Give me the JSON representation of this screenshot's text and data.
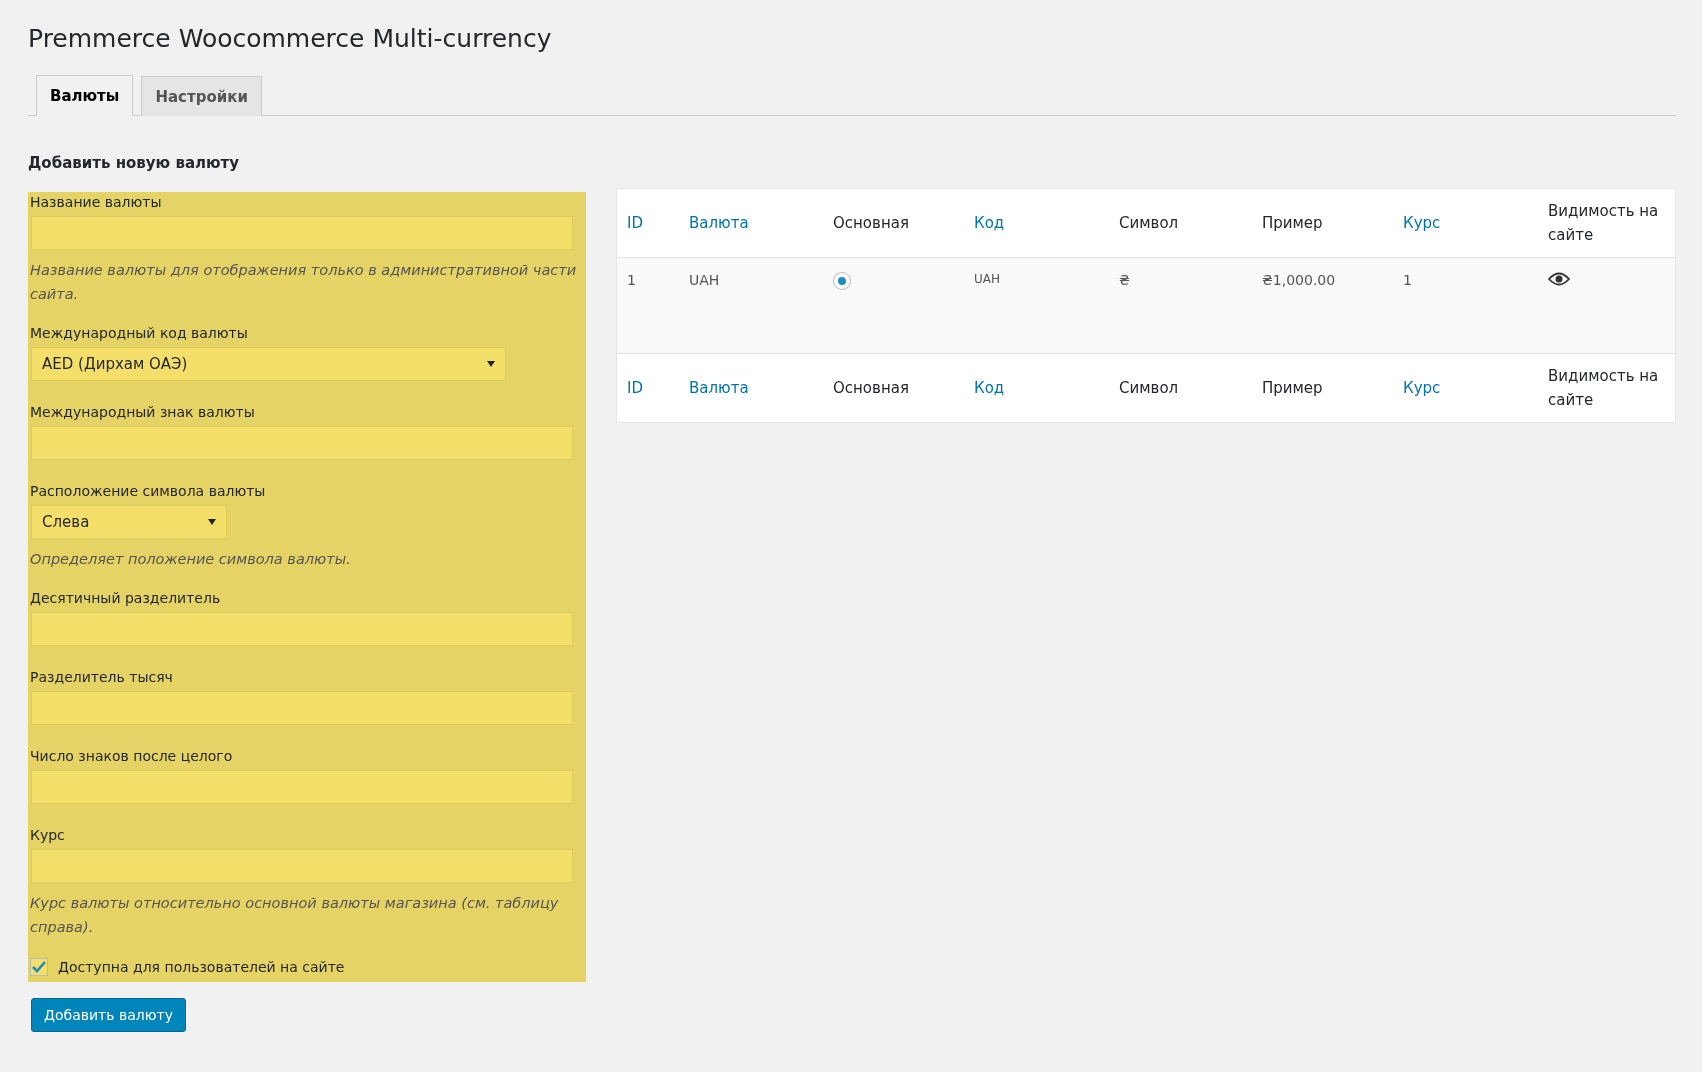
{
  "page_title": "Premmerce Woocommerce Multi-currency",
  "tabs": [
    {
      "label": "Валюты",
      "selected": true
    },
    {
      "label": "Настройки",
      "selected": false
    }
  ],
  "form": {
    "heading": "Добавить новую валюту",
    "fields": [
      {
        "kind": "text",
        "label": "Название валюты",
        "help": "Название валюты для отображения только в административной части сайта."
      },
      {
        "kind": "select",
        "label": "Международный код валюты",
        "value": "AED (Дирхам ОАЭ)"
      },
      {
        "kind": "text",
        "label": "Международный знак валюты"
      },
      {
        "kind": "select",
        "label": "Расположение символа валюты",
        "value": "Слева",
        "help": "Определяет положение символа валюты."
      },
      {
        "kind": "text",
        "label": "Десятичный разделитель"
      },
      {
        "kind": "text",
        "label": "Разделитель тысяч"
      },
      {
        "kind": "text",
        "label": "Число знаков после целого"
      },
      {
        "kind": "text",
        "label": "Курс",
        "help": "Курс валюты относительно основной валюты магазина (см. таблицу справа)."
      }
    ],
    "checkbox": {
      "label": "Доступна для пользователей на сайте",
      "checked": true
    },
    "submit": "Добавить валюту"
  },
  "table": {
    "columns": [
      {
        "label": "ID",
        "sortable": true
      },
      {
        "label": "Валюта",
        "sortable": true
      },
      {
        "label": "Основная",
        "sortable": false
      },
      {
        "label": "Код",
        "sortable": true
      },
      {
        "label": "Символ",
        "sortable": false
      },
      {
        "label": "Пример",
        "sortable": false
      },
      {
        "label": "Курс",
        "sortable": true
      },
      {
        "label": "Видимость на сайте",
        "sortable": false
      }
    ],
    "rows": [
      {
        "id": "1",
        "currency": "UAH",
        "primary": true,
        "code": "UAH",
        "symbol": "₴",
        "example": "₴1,000.00",
        "rate": "1",
        "visible": true
      }
    ],
    "footer_columns": [
      {
        "label": "ID",
        "sortable": true
      },
      {
        "label": "Валюта",
        "sortable": true
      },
      {
        "label": "Основная",
        "sortable": false
      },
      {
        "label": "Код",
        "sortable": true
      },
      {
        "label": "Символ",
        "sortable": false
      },
      {
        "label": "Пример",
        "sortable": false
      },
      {
        "label": "Курс",
        "sortable": true
      },
      {
        "label": "Видимость на сайте",
        "sortable": false
      }
    ]
  }
}
